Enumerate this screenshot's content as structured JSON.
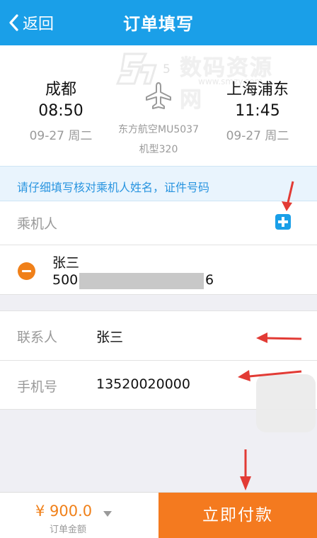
{
  "nav": {
    "back_label": "返回",
    "title": "订单填写"
  },
  "flight": {
    "departure": {
      "city": "成都",
      "time": "08:50",
      "date": "09-27 周二"
    },
    "arrival": {
      "city": "上海浦东",
      "time": "11:45",
      "date": "09-27 周二"
    },
    "airline": "东方航空MU5037",
    "aircraft_model": "机型320",
    "icon": "airplane-icon"
  },
  "watermark": {
    "main": "数码资源网",
    "sub": "www.smzy.com",
    "partial": "5"
  },
  "notice": "请仔细填写核对乘机人姓名，证件号码",
  "passengers": {
    "label": "乘机人",
    "add_icon": "plus-icon",
    "items": [
      {
        "name": "张三",
        "id_prefix": "500",
        "id_suffix": "6"
      }
    ]
  },
  "contact": {
    "contact_label": "联系人",
    "contact_value": "张三",
    "phone_label": "手机号",
    "phone_value": "13520020000"
  },
  "footer": {
    "price": "¥ 900.0",
    "price_label": "订单金额",
    "pay_label": "立即付款"
  },
  "colors": {
    "nav": "#1a9fe8",
    "accent_orange": "#f47a1f",
    "notice_text": "#2a95e0",
    "annotation_arrow": "#e23b35"
  }
}
